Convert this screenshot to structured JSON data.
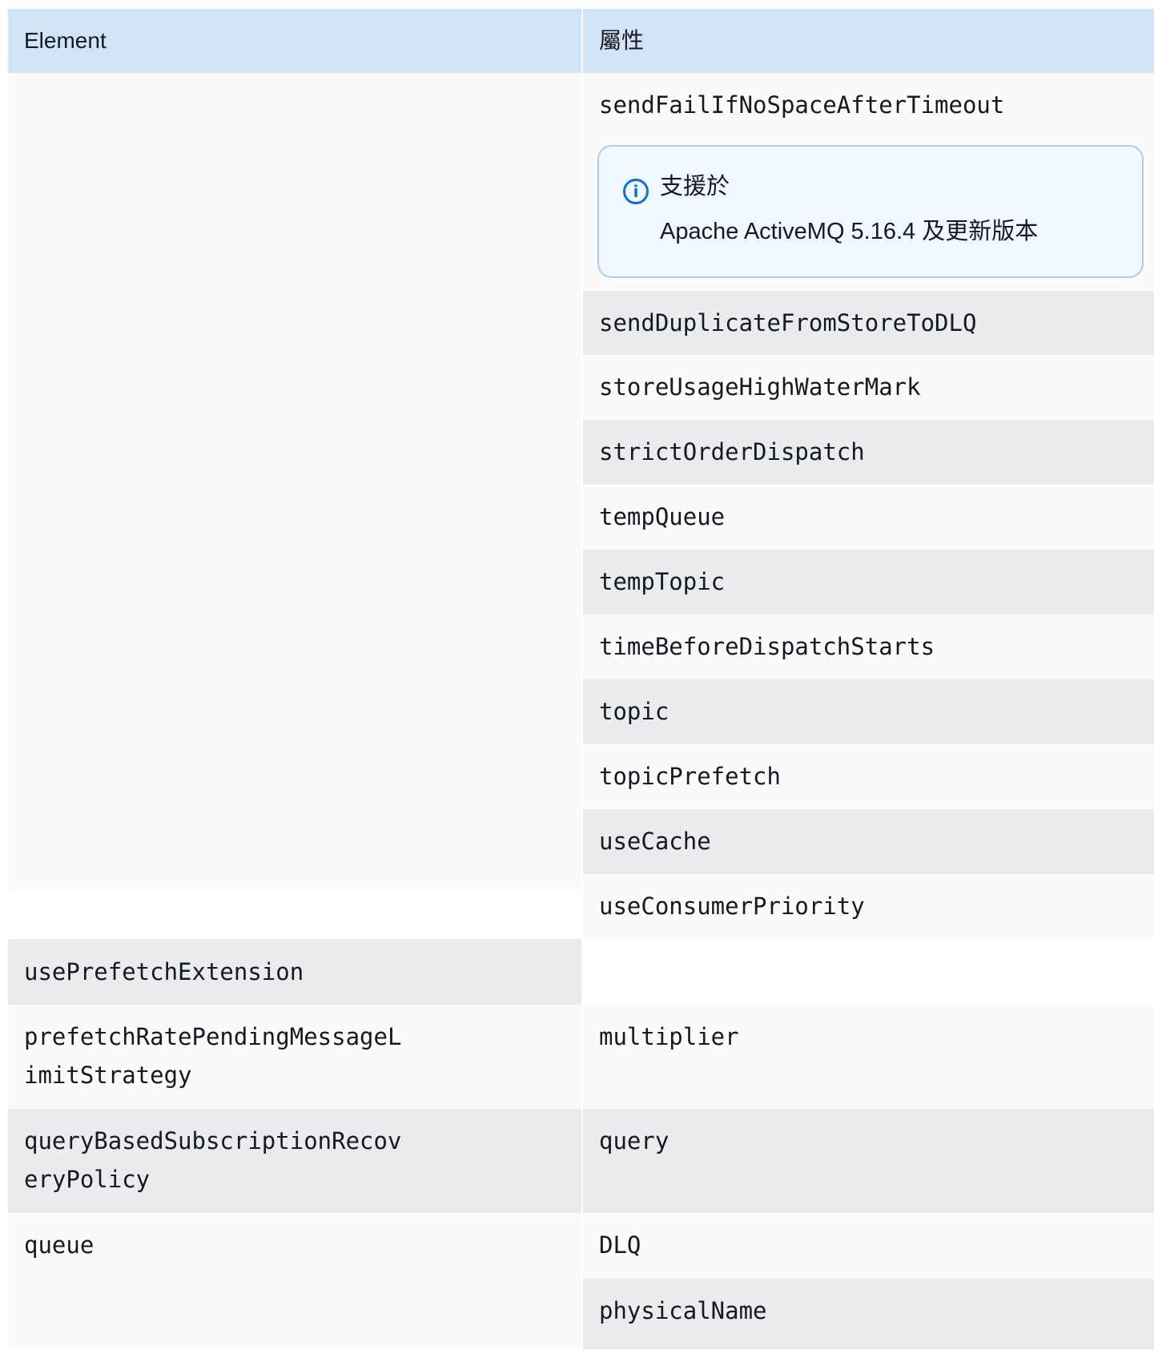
{
  "table": {
    "headers": {
      "element": "Element",
      "attributes": "屬性"
    },
    "first_group": {
      "element": "",
      "attributes": [
        "sendFailIfNoSpaceAfterTimeout"
      ],
      "note": {
        "icon": "info-icon",
        "title": "支援於",
        "text": "Apache ActiveMQ 5.16.4 及更新版本"
      },
      "more_attributes": [
        "sendDuplicateFromStoreToDLQ",
        "storeUsageHighWaterMark",
        "strictOrderDispatch",
        "tempQueue",
        "tempTopic",
        "timeBeforeDispatchStarts",
        "topic",
        "topicPrefetch",
        "useCache",
        "useConsumerPriority"
      ]
    },
    "rows": [
      {
        "element": "usePrefetchExtension",
        "attribute": ""
      },
      {
        "element": "prefetchRatePendingMessageL\nimitStrategy",
        "attribute": "multiplier"
      },
      {
        "element": "queryBasedSubscriptionRecov\neryPolicy",
        "attribute": "query"
      }
    ],
    "queue_group": {
      "element": "queue",
      "attributes": [
        "DLQ",
        "physicalName"
      ]
    }
  }
}
